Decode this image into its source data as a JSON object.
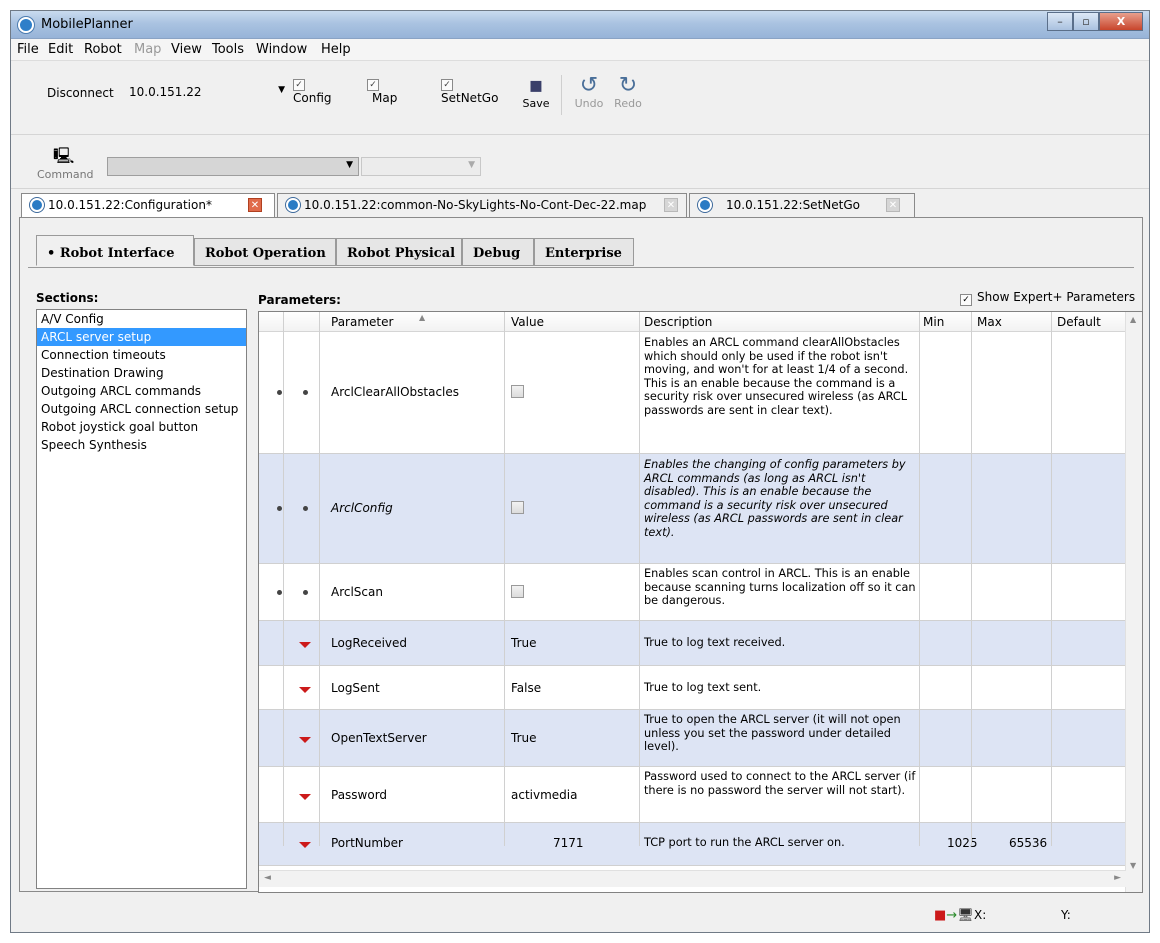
{
  "window": {
    "title": "MobilePlanner",
    "controls": [
      "–",
      "▫",
      "X"
    ]
  },
  "menu": [
    "File",
    "Edit",
    "Robot",
    "Map",
    "View",
    "Tools",
    "Window",
    "Help"
  ],
  "menu_disabled": [
    "Map"
  ],
  "toolbar": {
    "disconnect_label": "Disconnect",
    "ip_value": "10.0.151.22",
    "config_label": "Config",
    "map_label": "Map",
    "setnetgo_label": "SetNetGo",
    "save_label": "Save",
    "undo_label": "Undo",
    "redo_label": "Redo"
  },
  "command_bar": {
    "label": "Command",
    "combo_value": "",
    "combo2_value": ""
  },
  "doc_tabs": [
    {
      "label": "10.0.151.22:Configuration*",
      "active": true
    },
    {
      "label": "10.0.151.22:common-No-SkyLights-No-Cont-Dec-22.map",
      "active": false
    },
    {
      "label": "10.0.151.22:SetNetGo",
      "active": false
    }
  ],
  "sub_tabs": [
    "• Robot Interface",
    "Robot Operation",
    "Robot Physical",
    "Debug",
    "Enterprise"
  ],
  "sections": {
    "title": "Sections:",
    "items": [
      "A/V Config",
      "ARCL server setup",
      "Connection timeouts",
      "Destination Drawing",
      "Outgoing ARCL commands",
      "Outgoing ARCL connection setup",
      "Robot joystick goal button",
      "Speech Synthesis"
    ],
    "selected": "ARCL server setup"
  },
  "parameters": {
    "title": "Parameters:",
    "show_expert_label": "Show Expert+ Parameters",
    "columns": [
      "Parameter",
      "Value",
      "Description",
      "Min",
      "Max",
      "Default"
    ],
    "rows": [
      {
        "name": "ArclClearAllObstacles",
        "value": "",
        "checkbox": true,
        "description": "Enables an ARCL command clearAllObstacles which should only be used if the robot isn't moving, and won't for at least 1/4 of a second.  This is an enable because the command is a security risk over unsecured wireless (as ARCL passwords are sent in clear text).",
        "min": "",
        "max": "",
        "default": ""
      },
      {
        "name": "ArclConfig",
        "value": "",
        "checkbox": true,
        "description": "Enables the changing of config parameters by ARCL commands (as long as ARCL isn't disabled).  This is an enable because the command is a security risk over unsecured wireless (as ARCL passwords are sent in clear text).",
        "min": "",
        "max": "",
        "default": ""
      },
      {
        "name": "ArclScan",
        "value": "",
        "checkbox": true,
        "description": "Enables scan control in ARCL.  This is an enable because scanning turns localization off so it can be dangerous.",
        "min": "",
        "max": "",
        "default": ""
      },
      {
        "name": "LogReceived",
        "value": "True",
        "checkbox": false,
        "description": "True to log text received.",
        "min": "",
        "max": "",
        "default": ""
      },
      {
        "name": "LogSent",
        "value": "False",
        "checkbox": false,
        "description": "True to log text sent.",
        "min": "",
        "max": "",
        "default": ""
      },
      {
        "name": "OpenTextServer",
        "value": "True",
        "checkbox": false,
        "description": "True to open the ARCL server (it will not open unless you set the password under detailed level).",
        "min": "",
        "max": "",
        "default": ""
      },
      {
        "name": "Password",
        "value": "activmedia",
        "checkbox": false,
        "description": "Password used to connect to the ARCL server (if there is no password the server will not start).",
        "min": "",
        "max": "",
        "default": ""
      },
      {
        "name": "PortNumber",
        "value": "7171",
        "checkbox": false,
        "description": "TCP port to run the ARCL server on.",
        "min": "1025",
        "max": "65536",
        "default": ""
      }
    ]
  },
  "status": {
    "x_label": "X:",
    "y_label": "Y:"
  },
  "colors": {
    "selection": "#3399ff",
    "alt_row": "#dde4f4",
    "arrow_red": "#cc1a1a"
  }
}
